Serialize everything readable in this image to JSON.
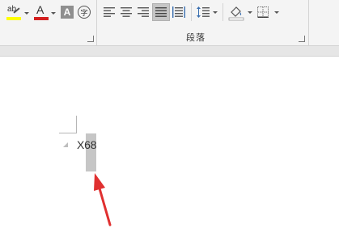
{
  "ribbon": {
    "paragraph_group_label": "段落",
    "icons": {
      "text_highlight": "text-highlight-color-icon",
      "font_color": "font-color-icon",
      "character_shading": "character-shading-icon",
      "enclose_characters": "enclose-characters-icon",
      "align_left": "align-left-icon",
      "center": "align-center-icon",
      "align_right": "align-right-icon",
      "justify": "justify-icon",
      "distributed": "distributed-icon",
      "line_spacing": "line-spacing-icon",
      "shading": "shading-icon",
      "borders": "borders-icon"
    },
    "labels": {
      "highlight_letters": "ab",
      "font_color_letter": "A",
      "shading_letter": "A",
      "enclose_char": "字"
    },
    "colors": {
      "highlight": "#ffff00",
      "font_color": "#d32020",
      "active_button": "#c5c5c5"
    }
  },
  "document": {
    "text": "X68"
  },
  "annotation": {
    "arrow_color": "#e03030"
  }
}
